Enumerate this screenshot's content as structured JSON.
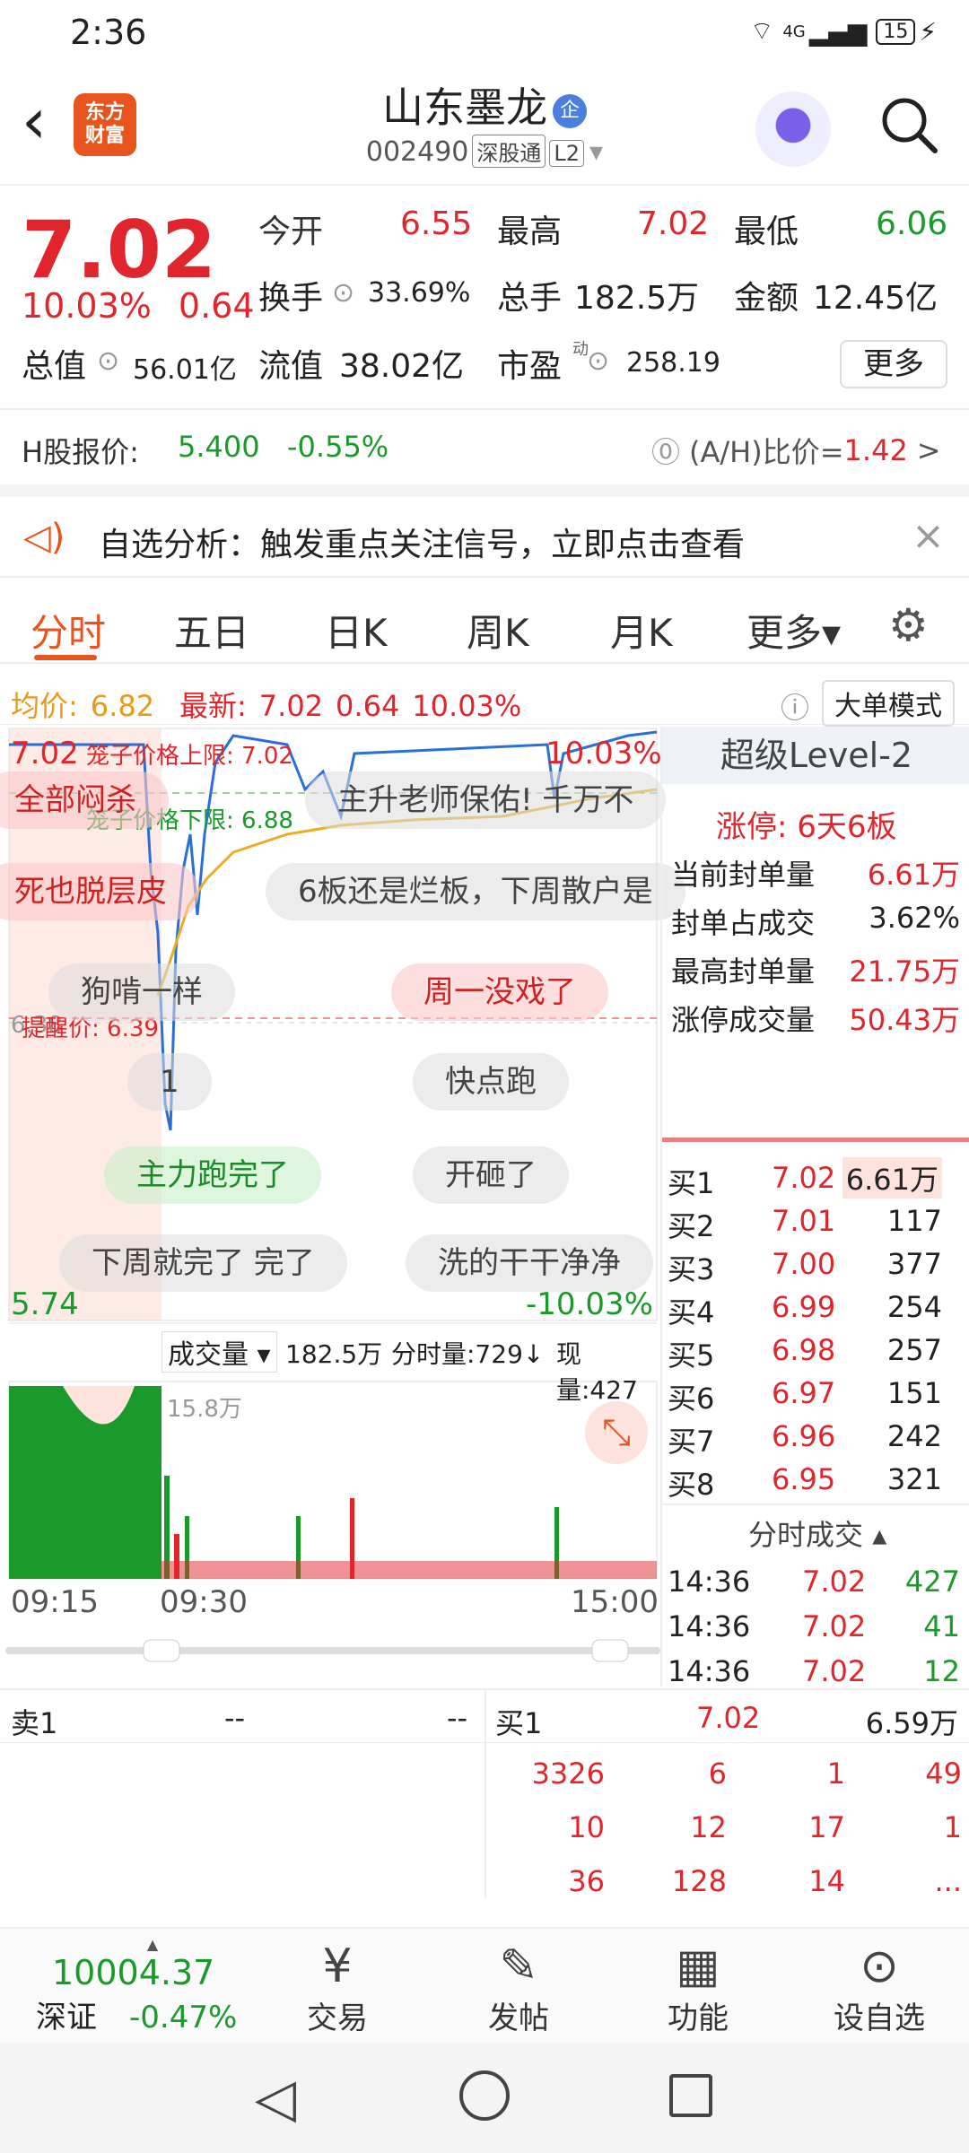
{
  "status": {
    "time": "2:36",
    "network": "4G",
    "battery": "15"
  },
  "header": {
    "logo_line1": "东方",
    "logo_line2": "财富",
    "name": "山东墨龙",
    "badge": "企",
    "code": "002490",
    "tag1": "深股通",
    "tag2": "L2"
  },
  "quote": {
    "price": "7.02",
    "pct": "10.03%",
    "chg": "0.64",
    "open_label": "今开",
    "open": "6.55",
    "high_label": "最高",
    "high": "7.02",
    "low_label": "最低",
    "low": "6.06",
    "turnover_label": "换手",
    "turnover": "33.69%",
    "vol_label": "总手",
    "vol": "182.5万",
    "amount_label": "金额",
    "amount": "12.45亿",
    "cap_label": "总值",
    "cap": "56.01亿",
    "float_label": "流值",
    "float": "38.02亿",
    "pe_label": "市盈",
    "pe_sup": "动",
    "pe": "258.19",
    "more": "更多",
    "h_label": "H股报价:",
    "h_price": "5.400",
    "h_pct": "-0.55%",
    "ah_label": "(A/H)比价=",
    "ah_value": "1.42"
  },
  "notice": {
    "text": "自选分析：触发重点关注信号，立即点击查看"
  },
  "tabs": [
    "分时",
    "五日",
    "日K",
    "周K",
    "月K",
    "更多▾"
  ],
  "avg": {
    "label": "均价:",
    "value": "6.82",
    "latest_label": "最新:",
    "latest": "7.02",
    "chg": "0.64",
    "pct": "10.03%",
    "mode": "大单模式"
  },
  "chart": {
    "top_left": "7.02",
    "top_right": "10.03%",
    "bottom_left": "5.74",
    "bottom_right": "-10.03%",
    "upper_limit": "笼子价格上限: 7.02",
    "lower_limit": "笼子价格下限: 6.88",
    "alert": "提醒价: 6.39",
    "mid_left": "6.38",
    "vol_label": "成交量",
    "vol_total": "182.5万",
    "tick_label": "分时量:729↓",
    "cur_label": "现量:427",
    "vol_max": "15.8万",
    "t_start": "09:15",
    "t_mid": "09:30",
    "t_end": "15:00"
  },
  "bubbles": [
    "全部闷杀",
    "主升老师保佑! 千万不",
    "死也脱层皮",
    "6板还是烂板，下周散户是",
    "狗啃一样",
    "周一没戏了",
    "1",
    "快点跑",
    "主力跑完了",
    "开砸了",
    "下周就完了 完了",
    "洗的干干净净"
  ],
  "level2": {
    "title": "超级Level-2",
    "limit": "涨停: 6天6板",
    "rows": [
      {
        "k": "当前封单量",
        "v": "6.61万"
      },
      {
        "k": "封单占成交",
        "v": "3.62%"
      },
      {
        "k": "最高封单量",
        "v": "21.75万"
      },
      {
        "k": "涨停成交量",
        "v": "50.43万"
      }
    ],
    "bids": [
      {
        "k": "买1",
        "p": "7.02",
        "v": "6.61万"
      },
      {
        "k": "买2",
        "p": "7.01",
        "v": "117"
      },
      {
        "k": "买3",
        "p": "7.00",
        "v": "377"
      },
      {
        "k": "买4",
        "p": "6.99",
        "v": "254"
      },
      {
        "k": "买5",
        "p": "6.98",
        "v": "257"
      },
      {
        "k": "买6",
        "p": "6.97",
        "v": "151"
      },
      {
        "k": "买7",
        "p": "6.96",
        "v": "242"
      },
      {
        "k": "买8",
        "p": "6.95",
        "v": "321"
      }
    ],
    "ticks_title": "分时成交",
    "ticks": [
      {
        "t": "14:36",
        "p": "7.02",
        "v": "427"
      },
      {
        "t": "14:36",
        "p": "7.02",
        "v": "41"
      },
      {
        "t": "14:36",
        "p": "7.02",
        "v": "12"
      }
    ]
  },
  "orderbook": {
    "sell_label": "卖1",
    "sell_p": "--",
    "sell_v": "--",
    "buy_label": "买1",
    "buy_p": "7.02",
    "buy_v": "6.59万",
    "rows": [
      [
        "3326",
        "6",
        "1",
        "49"
      ],
      [
        "10",
        "12",
        "17",
        "1"
      ],
      [
        "36",
        "128",
        "14",
        "..."
      ]
    ]
  },
  "bottom": {
    "index": "10004.37",
    "index_name": "深证",
    "index_pct": "-0.47%",
    "trade": "交易",
    "post": "发帖",
    "func": "功能",
    "fav": "设自选"
  }
}
